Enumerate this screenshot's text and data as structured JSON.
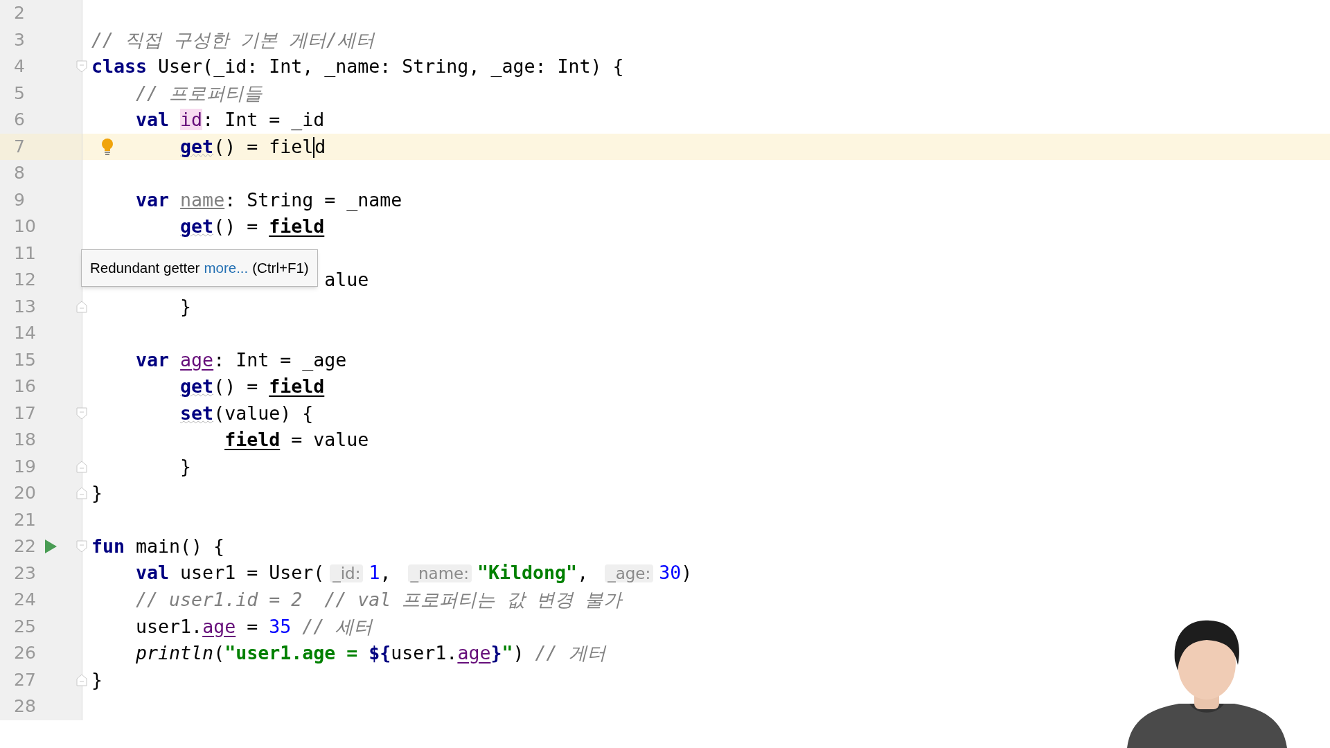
{
  "editor": {
    "lines": [
      {
        "number": "2"
      },
      {
        "number": "3",
        "tokens": [
          {
            "text": "// 직접 구성한 기본 게터/세터",
            "kind": "comment"
          }
        ]
      },
      {
        "number": "4",
        "fold_start": true,
        "tokens": [
          {
            "text": "class ",
            "kind": "keyword"
          },
          {
            "text": "User(_id: Int, _name: String, _age: Int) {",
            "kind": "plain"
          }
        ]
      },
      {
        "number": "5",
        "tokens": [
          {
            "text": "    // 프로퍼티들",
            "kind": "comment"
          }
        ]
      },
      {
        "number": "6",
        "tokens": [
          {
            "text": "    val ",
            "kind": "keyword"
          },
          {
            "text": "id",
            "kind": "usage"
          },
          {
            "text": ": Int = _id",
            "kind": "plain"
          }
        ]
      },
      {
        "number": "7",
        "current": true,
        "bulb": true,
        "tokens": [
          {
            "text": "        get",
            "kind": "accessor"
          },
          {
            "text": "() = fiel",
            "kind": "plain",
            "caret": true
          },
          {
            "text": "d",
            "kind": "plain"
          }
        ]
      },
      {
        "number": "8"
      },
      {
        "number": "9",
        "tokens": [
          {
            "text": "    var ",
            "kind": "keyword"
          },
          {
            "text": "name",
            "kind": "unused"
          },
          {
            "text": ": String = _name",
            "kind": "plain"
          }
        ]
      },
      {
        "number": "10",
        "tokens": [
          {
            "text": "        get",
            "kind": "accessor"
          },
          {
            "text": "() = ",
            "kind": "plain"
          },
          {
            "text": "field",
            "kind": "field"
          }
        ]
      },
      {
        "number": "11"
      },
      {
        "number": "12",
        "tokens": [
          {
            "text": "                     alue",
            "kind": "plain"
          }
        ]
      },
      {
        "number": "13",
        "fold_end": true,
        "tokens": [
          {
            "text": "        }",
            "kind": "plain"
          }
        ]
      },
      {
        "number": "14"
      },
      {
        "number": "15",
        "tokens": [
          {
            "text": "    var ",
            "kind": "keyword"
          },
          {
            "text": "age",
            "kind": "property"
          },
          {
            "text": ": Int = _age",
            "kind": "plain"
          }
        ]
      },
      {
        "number": "16",
        "tokens": [
          {
            "text": "        get",
            "kind": "accessor"
          },
          {
            "text": "() = ",
            "kind": "plain"
          },
          {
            "text": "field",
            "kind": "field"
          }
        ]
      },
      {
        "number": "17",
        "fold_start": true,
        "tokens": [
          {
            "text": "        set",
            "kind": "accessor"
          },
          {
            "text": "(value) {",
            "kind": "plain"
          }
        ]
      },
      {
        "number": "18",
        "tokens": [
          {
            "text": "            field",
            "kind": "field"
          },
          {
            "text": " = value",
            "kind": "plain"
          }
        ]
      },
      {
        "number": "19",
        "fold_end": true,
        "tokens": [
          {
            "text": "        }",
            "kind": "plain"
          }
        ]
      },
      {
        "number": "20",
        "fold_end": true,
        "tokens": [
          {
            "text": "}",
            "kind": "plain"
          }
        ]
      },
      {
        "number": "21"
      },
      {
        "number": "22",
        "fold_start": true,
        "run": true,
        "tokens": [
          {
            "text": "fun ",
            "kind": "keyword"
          },
          {
            "text": "main() {",
            "kind": "plain"
          }
        ]
      },
      {
        "number": "23",
        "tokens": [
          {
            "text": "    val ",
            "kind": "keyword"
          },
          {
            "text": "user1 = User(",
            "kind": "plain"
          },
          {
            "text": "_id:",
            "kind": "hint"
          },
          {
            "text": "1",
            "kind": "number"
          },
          {
            "text": ", ",
            "kind": "plain"
          },
          {
            "text": "_name:",
            "kind": "hint"
          },
          {
            "text": "\"Kildong\"",
            "kind": "string"
          },
          {
            "text": ", ",
            "kind": "plain"
          },
          {
            "text": "_age:",
            "kind": "hint"
          },
          {
            "text": "30",
            "kind": "number"
          },
          {
            "text": ")",
            "kind": "plain"
          }
        ]
      },
      {
        "number": "24",
        "tokens": [
          {
            "text": "    // user1.id = 2  // val 프로퍼티는 값 변경 불가",
            "kind": "comment"
          }
        ]
      },
      {
        "number": "25",
        "tokens": [
          {
            "text": "    user1.",
            "kind": "plain"
          },
          {
            "text": "age",
            "kind": "property"
          },
          {
            "text": " = ",
            "kind": "plain"
          },
          {
            "text": "35",
            "kind": "number"
          },
          {
            "text": " // 세터",
            "kind": "comment"
          }
        ]
      },
      {
        "number": "26",
        "tokens": [
          {
            "text": "    println",
            "kind": "call"
          },
          {
            "text": "(",
            "kind": "plain"
          },
          {
            "text": "\"user1.age = ",
            "kind": "string"
          },
          {
            "text": "${",
            "kind": "keyword"
          },
          {
            "text": "user1.",
            "kind": "plain"
          },
          {
            "text": "age",
            "kind": "property"
          },
          {
            "text": "}",
            "kind": "keyword"
          },
          {
            "text": "\"",
            "kind": "string"
          },
          {
            "text": ")",
            "kind": "plain"
          },
          {
            "text": " // 게터",
            "kind": "comment"
          }
        ]
      },
      {
        "number": "27",
        "fold_end": true,
        "tokens": [
          {
            "text": "}",
            "kind": "plain"
          }
        ]
      },
      {
        "number": "28"
      }
    ]
  },
  "tooltip": {
    "message": "Redundant getter",
    "link": "more...",
    "shortcut": "(Ctrl+F1)"
  }
}
